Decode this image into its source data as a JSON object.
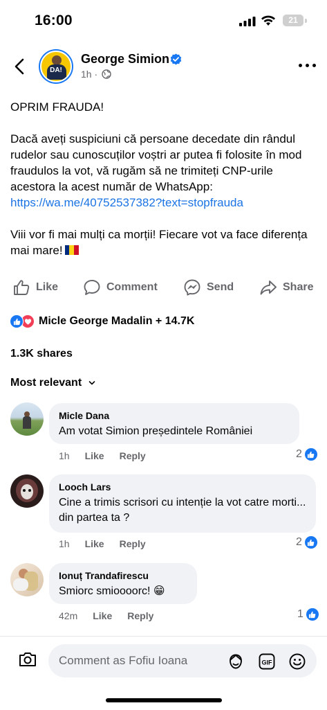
{
  "status_bar": {
    "time": "16:00",
    "battery": "21"
  },
  "header": {
    "author": "George Simion",
    "time_ago": "1h",
    "separator": "·",
    "avatar_text": "DA!"
  },
  "post": {
    "title": "OPRIM FRAUDA!",
    "body": "Dacă aveți suspiciuni că persoane decedate din rândul rudelor sau cunoscuților voștri ar putea fi folosite în mod fraudulos la vot, vă rugăm să ne trimiteți CNP-urile acestora la acest număr de WhatsApp:",
    "link": "https://wa.me/40752537382?text=stopfrauda",
    "closing": "Viii vor fi mai mulți ca morții! Fiecare vot va face diferența mai mare!"
  },
  "actions": {
    "like": "Like",
    "comment": "Comment",
    "send": "Send",
    "share": "Share"
  },
  "reactions_summary": "Micle George Madalin + 14.7K",
  "shares": "1.3K shares",
  "sort_label": "Most relevant",
  "comments": [
    {
      "author": "Micle Dana",
      "text": "Am  votat Simion  președintele României",
      "time": "1h",
      "like": "Like",
      "reply": "Reply",
      "reactions": "2"
    },
    {
      "author": "Looch Lars",
      "text": "Cine a trimis scrisori cu intenție la vot catre morti... din partea ta ?",
      "time": "1h",
      "like": "Like",
      "reply": "Reply",
      "reactions": "2"
    },
    {
      "author": "Ionuț Trandafirescu",
      "text": "Smiorc smioooorc! 😁",
      "time": "42m",
      "like": "Like",
      "reply": "Reply",
      "reactions": "1"
    }
  ],
  "composer": {
    "placeholder": "Comment as Fofiu Ioana"
  },
  "colors": {
    "accent": "#1877f2",
    "link": "#1b74e4",
    "love": "#f33e58",
    "muted": "#65676b"
  },
  "icons": [
    "back-chevron-icon",
    "verified-badge-icon",
    "globe-icon",
    "more-icon",
    "like-icon",
    "comment-icon",
    "messenger-icon",
    "share-icon",
    "chevron-down-icon",
    "camera-icon",
    "avatar-sticker-icon",
    "gif-icon",
    "emoji-icon"
  ]
}
